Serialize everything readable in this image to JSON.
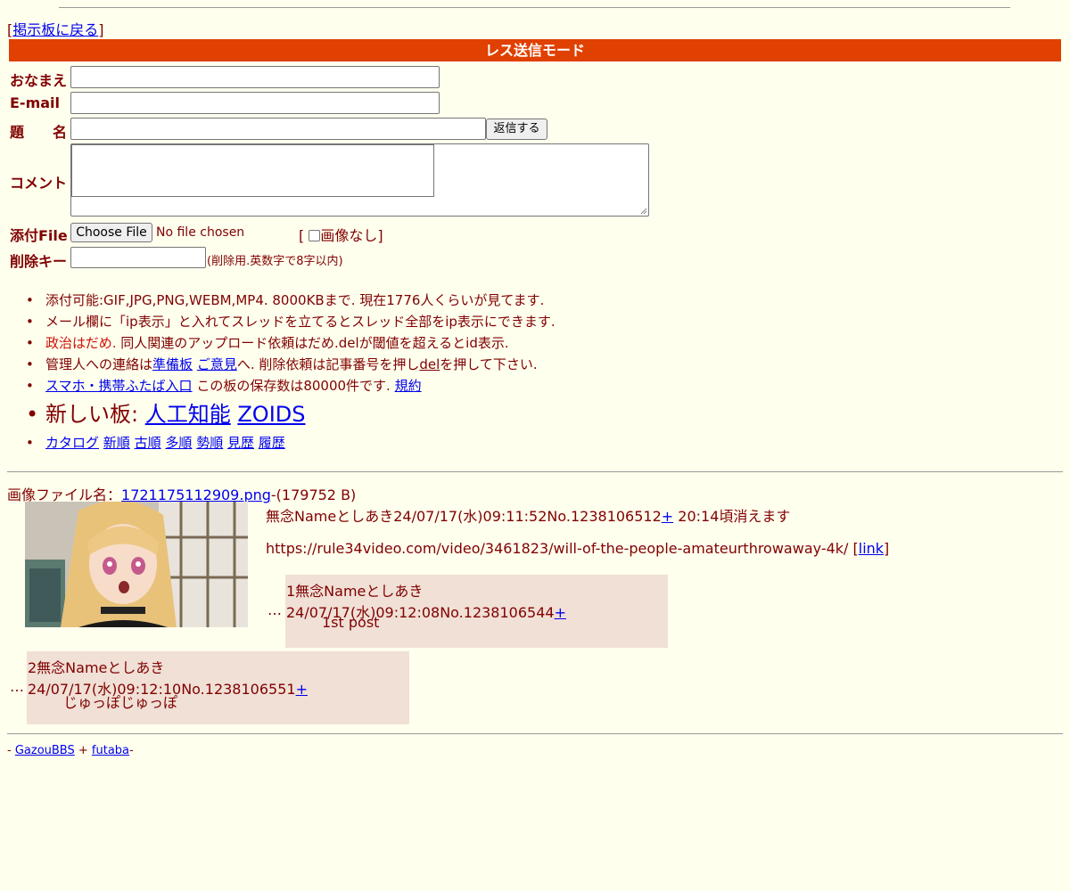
{
  "nav": {
    "back_open": "[",
    "back_label": "掲示板に戻る",
    "back_close": "]"
  },
  "banner": "レス送信モード",
  "form": {
    "name_label": "おなまえ",
    "email_label": "E-mail",
    "subject_label": "題　　名",
    "submit_label": "返信する",
    "comment_label": "コメント",
    "file_label": "添付File",
    "choose_file_label": "Choose File",
    "no_file_text": "No file chosen",
    "noimage_open": "[",
    "noimage_label": "画像なし",
    "noimage_close": "]",
    "delkey_label": "削除キー",
    "delkey_note": "(削除用.英数字で8字以内)"
  },
  "notes": {
    "line1": "添付可能:GIF,JPG,PNG,WEBM,MP4. 8000KBまで. 現在1776人くらいが見てます.",
    "line2": "メール欄に「ip表示」と入れてスレッドを立てるとスレッド全部をip表示にできます.",
    "line3_red": "政治はだめ.",
    "line3_rest": " 同人関連のアップロード依頼はだめ.delが閾値を超えるとid表示.",
    "line4_a": "管理人への連絡は",
    "line4_link1": "準備板",
    "line4_link2": "ご意見",
    "line4_b": "へ. 削除依頼は記事番号を押し",
    "line4_del": "del",
    "line4_c": "を押して下さい.",
    "line5_link": "スマホ・携帯ふたば入口",
    "line5_text": " この板の保存数は80000件です. ",
    "line5_rules": "規約",
    "line6_text": "新しい板: ",
    "line6_link1": "人工知能",
    "line6_link2": "ZOIDS",
    "line7_links": [
      "カタログ",
      "新順",
      "古順",
      "多順",
      "勢順",
      "見歴",
      "履歴"
    ]
  },
  "op": {
    "file_prefix": "画像ファイル名：",
    "file_name": "1721175112909.png",
    "file_size": "-(179752 B)",
    "header": "無念Nameとしあき24/07/17(水)09:11:52No.1238106512",
    "plus": "+",
    "expire": " 20:14頃消えます",
    "body": "https://rule34video.com/video/3461823/will-of-the-people-amateurthrowaway-4k/",
    "link_open": " [",
    "link_label": "link",
    "link_close": "]"
  },
  "replies": [
    {
      "header": "1無念Nameとしあき24/07/17(水)09:12:08No.1238106544",
      "plus": "+",
      "body": "1st post"
    },
    {
      "header": "2無念Nameとしあき24/07/17(水)09:12:10No.1238106551",
      "plus": "+",
      "body": "じゅっぽじゅっぽ"
    }
  ],
  "ellipsis": "…",
  "footer": {
    "pre": "- ",
    "link1": "GazouBBS",
    "mid": " + ",
    "link2": "futaba",
    "post": "-"
  }
}
